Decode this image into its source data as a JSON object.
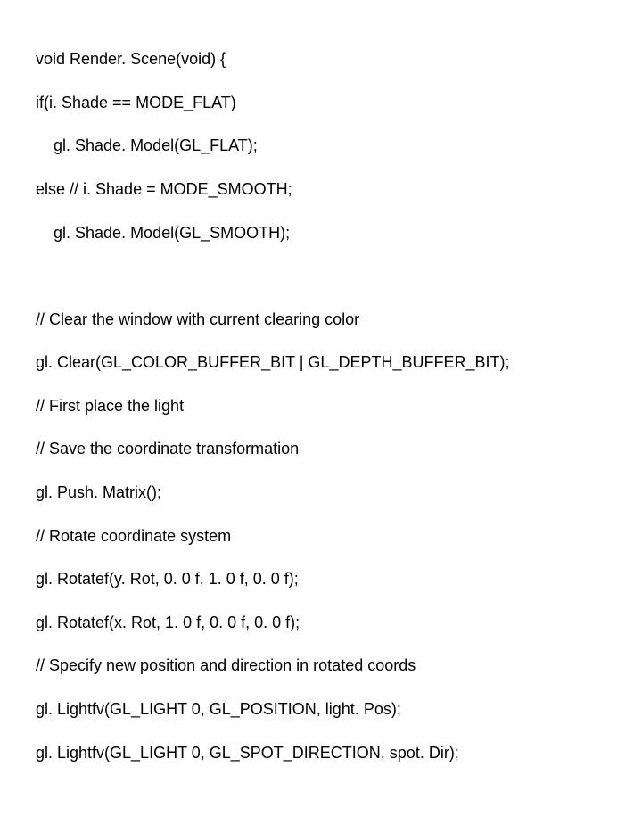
{
  "code": {
    "line1": "void Render. Scene(void) {",
    "line2": "if(i. Shade == MODE_FLAT)",
    "line3": "    gl. Shade. Model(GL_FLAT);",
    "line4": "else // i. Shade = MODE_SMOOTH;",
    "line5": "    gl. Shade. Model(GL_SMOOTH);",
    "line6": "// Clear the window with current clearing color",
    "line7": "gl. Clear(GL_COLOR_BUFFER_BIT | GL_DEPTH_BUFFER_BIT);",
    "line8": "// First place the light",
    "line9": "// Save the coordinate transformation",
    "line10": "gl. Push. Matrix();",
    "line11": "// Rotate coordinate system",
    "line12": "gl. Rotatef(y. Rot, 0. 0 f, 1. 0 f, 0. 0 f);",
    "line13": "gl. Rotatef(x. Rot, 1. 0 f, 0. 0 f, 0. 0 f);",
    "line14": "// Specify new position and direction in rotated coords",
    "line15": "gl. Lightfv(GL_LIGHT 0, GL_POSITION, light. Pos);",
    "line16": "gl. Lightfv(GL_LIGHT 0, GL_SPOT_DIRECTION, spot. Dir);"
  }
}
